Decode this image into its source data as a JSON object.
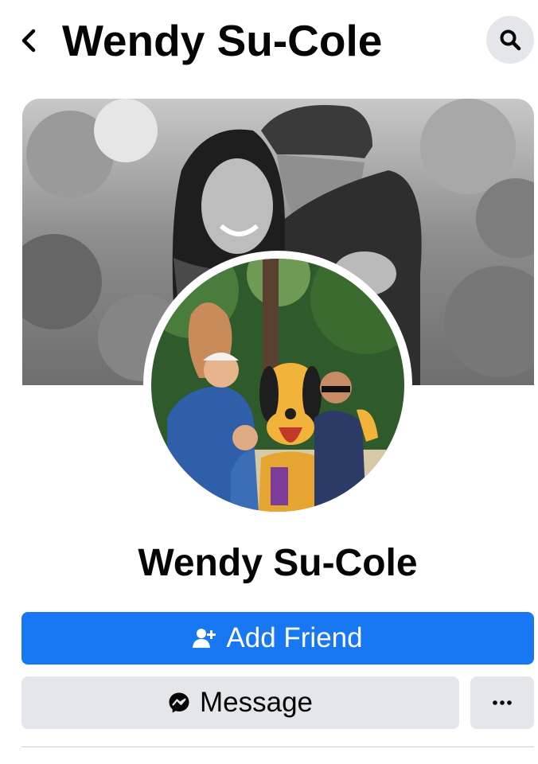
{
  "header": {
    "title": "Wendy Su-Cole"
  },
  "profile": {
    "name": "Wendy Su-Cole"
  },
  "actions": {
    "add_friend_label": "Add Friend",
    "message_label": "Message"
  },
  "colors": {
    "primary": "#1877f2",
    "secondary_button": "#e4e6eb",
    "text": "#050505"
  },
  "icons": [
    "back-arrow-icon",
    "search-icon",
    "add-friend-icon",
    "messenger-icon",
    "more-icon"
  ]
}
